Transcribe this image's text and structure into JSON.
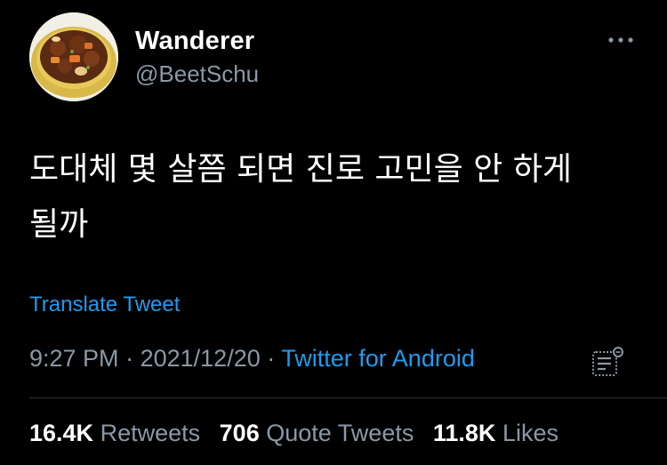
{
  "user": {
    "display_name": "Wanderer",
    "handle": "@BeetSchu",
    "avatar_icon": "beef-stew-bowl-icon"
  },
  "tweet": {
    "text_line1": "도대체 몇 살쯤 되면 진로 고민을 안 하게",
    "text_line2": "될까",
    "translate_label": "Translate Tweet",
    "time": "9:27 PM",
    "separator": "·",
    "date": "2021/12/20",
    "source": "Twitter for Android"
  },
  "stats": {
    "retweets_count": "16.4K",
    "retweets_label": "Retweets",
    "quotes_count": "706",
    "quotes_label": "Quote Tweets",
    "likes_count": "11.8K",
    "likes_label": "Likes"
  },
  "colors": {
    "background": "#000000",
    "primary_text": "#ffffff",
    "secondary_text": "#8b98a5",
    "link": "#1d9bf0",
    "divider": "#2f3336"
  }
}
